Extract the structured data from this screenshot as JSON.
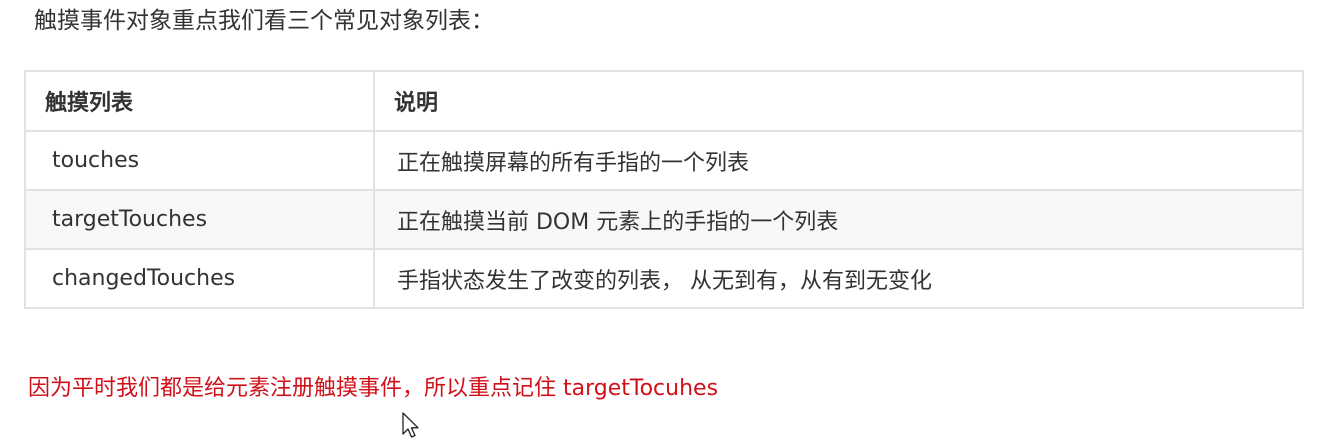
{
  "intro": "触摸事件对象重点我们看三个常见对象列表：",
  "table": {
    "headers": [
      "触摸列表",
      "说明"
    ],
    "rows": [
      {
        "name": "touches",
        "desc": "正在触摸屏幕的所有手指的一个列表"
      },
      {
        "name": "targetTouches",
        "desc": "正在触摸当前 DOM 元素上的手指的一个列表"
      },
      {
        "name": "changedTouches",
        "desc": "手指状态发生了改变的列表， 从无到有，从有到无变化"
      }
    ]
  },
  "note": "因为平时我们都是给元素注册触摸事件，所以重点记住 targetTocuhes",
  "colors": {
    "text": "#333333",
    "note": "#d0111a",
    "border": "#e2e2e2",
    "alt_row": "#f8f8f8"
  },
  "icons": {
    "cursor": "mouse-pointer-icon"
  }
}
